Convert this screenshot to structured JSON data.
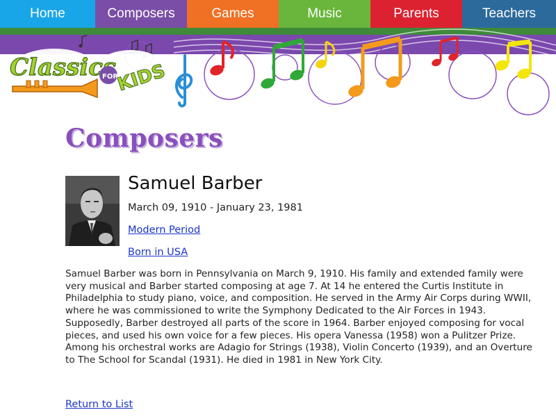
{
  "nav": {
    "items": [
      {
        "label": "Home"
      },
      {
        "label": "Composers"
      },
      {
        "label": "Games"
      },
      {
        "label": "Music"
      },
      {
        "label": "Parents"
      },
      {
        "label": "Teachers"
      }
    ]
  },
  "logo": {
    "line1": "Classics",
    "line2a": "FOR",
    "line2b": "KIDS"
  },
  "main": {
    "section_title": "Composers",
    "composer": {
      "name": "Samuel Barber",
      "dates": "March 09, 1910 - January 23, 1981",
      "period_link": "Modern Period",
      "born_link": "Born in USA",
      "bio": "Samuel Barber was born in Pennsylvania on March 9, 1910. His family and extended family were very musical and Barber started composing at age 7. At 14 he entered the Curtis Institute in Philadelphia to study piano, voice, and composition. He served in the Army Air Corps during WWII, where he was commissioned to write the Symphony Dedicated to the Air Forces in 1943. Supposedly, Barber destroyed all parts of the score in 1964. Barber enjoyed composing for vocal pieces, and used his own voice for a few pieces. His opera Vanessa (1958) won a Pulitzer Prize. Among his orchestral works are Adagio for Strings (1938), Violin Concerto (1939), and an Overture to The School for Scandal (1931). He died in 1981 in New York City."
    },
    "return_link": "Return to List"
  },
  "colors": {
    "home": "#19a6e8",
    "composers": "#7a4ea6",
    "games": "#f07024",
    "music": "#6ab63c",
    "parents": "#dc2230",
    "teachers": "#2c6a9c",
    "band": "#7b48ad",
    "link": "#1a35c8"
  }
}
